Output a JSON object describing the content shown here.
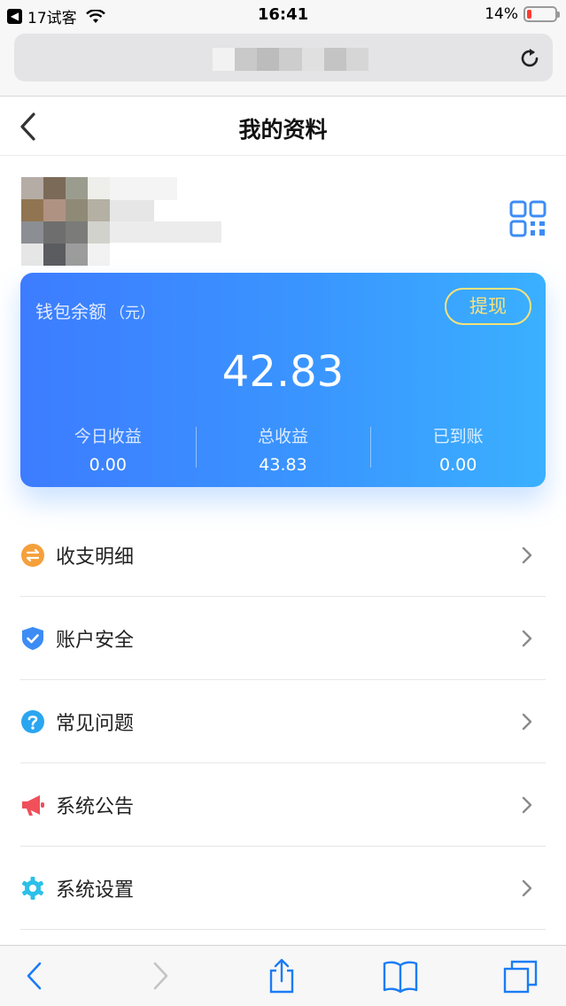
{
  "status_bar": {
    "back_app": "17试客",
    "time": "16:41",
    "battery": "14%"
  },
  "nav": {
    "title": "我的资料"
  },
  "wallet": {
    "label": "钱包余额",
    "unit": "（元）",
    "withdraw_label": "提现",
    "balance": "42.83",
    "stats": [
      {
        "label": "今日收益",
        "value": "0.00"
      },
      {
        "label": "总收益",
        "value": "43.83"
      },
      {
        "label": "已到账",
        "value": "0.00"
      }
    ]
  },
  "menu": [
    {
      "label": "收支明细",
      "icon": "transfer-icon",
      "color": "#f5a03a"
    },
    {
      "label": "账户安全",
      "icon": "shield-check-icon",
      "color": "#3d8cf5"
    },
    {
      "label": "常见问题",
      "icon": "question-icon",
      "color": "#2aa6f0"
    },
    {
      "label": "系统公告",
      "icon": "megaphone-icon",
      "color": "#f0505a"
    },
    {
      "label": "系统设置",
      "icon": "gear-icon",
      "color": "#2cc0e8"
    }
  ],
  "colors": {
    "accent": "#3a8dff",
    "withdraw": "#f9e27a",
    "ios_blue": "#1a7cf5"
  }
}
